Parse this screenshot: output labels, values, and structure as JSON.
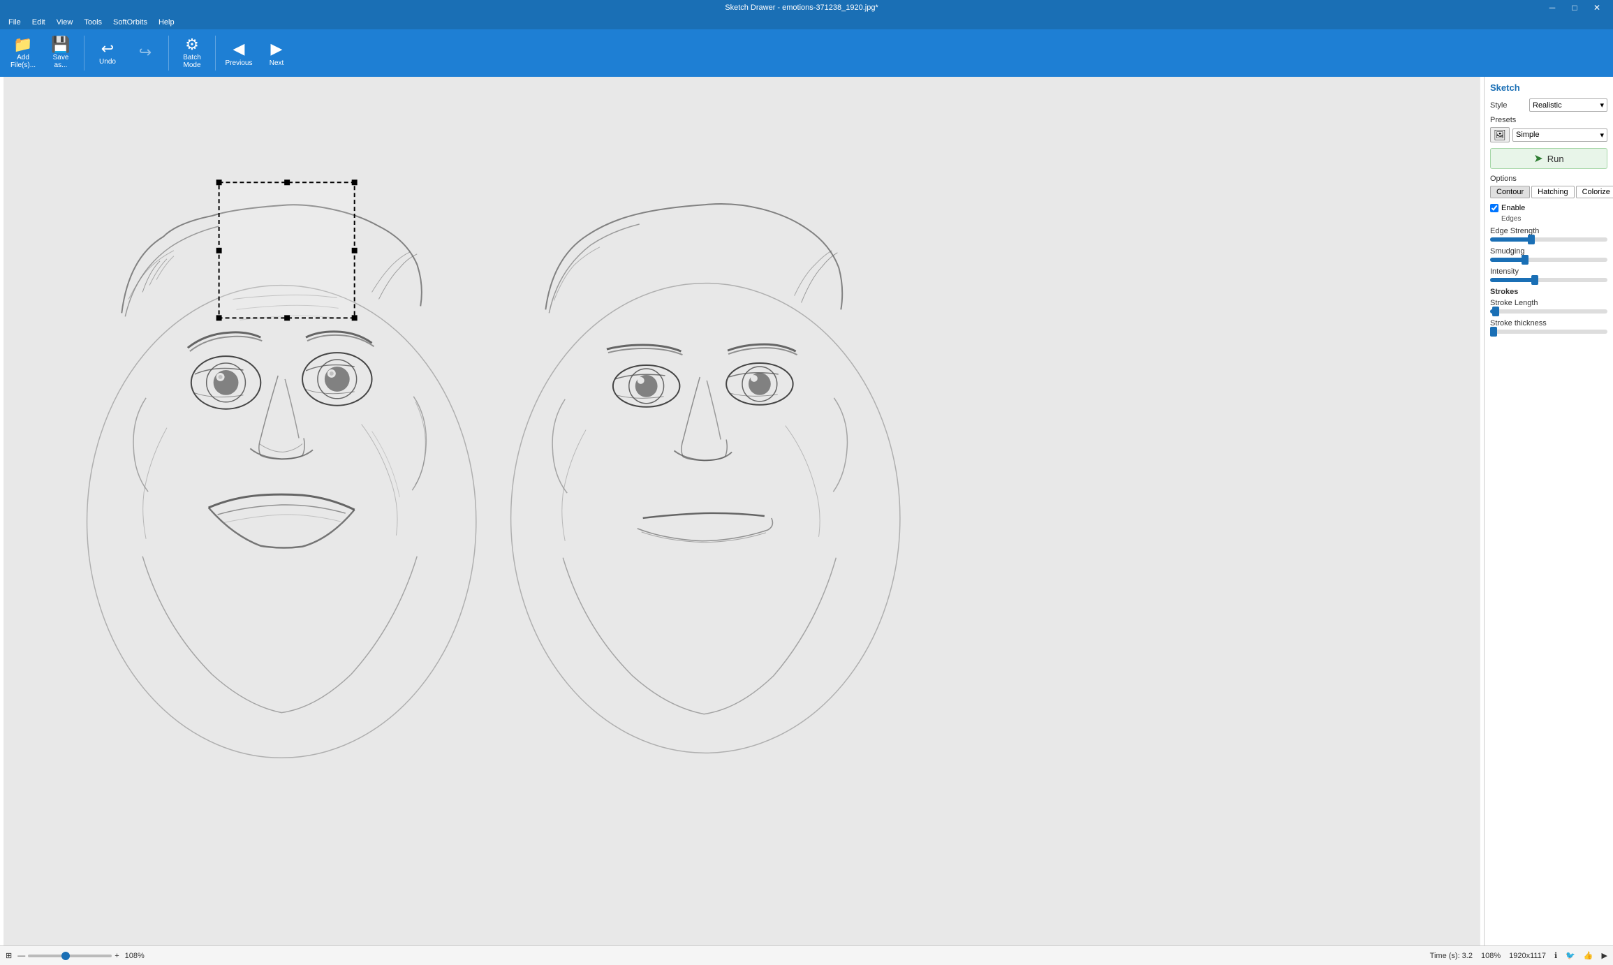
{
  "window": {
    "title": "Sketch Drawer - emotions-371238_1920.jpg*",
    "minimize_label": "─",
    "maximize_label": "□",
    "close_label": "✕"
  },
  "menu": {
    "items": [
      "File",
      "Edit",
      "View",
      "Tools",
      "SoftOrbits",
      "Help"
    ]
  },
  "toolbar": {
    "add_files_label": "Add\nFile(s)...",
    "save_as_label": "Save\nas...",
    "undo_label": "Undo",
    "redo_label": "",
    "batch_mode_label": "Batch\nMode",
    "previous_label": "Previous",
    "next_label": "Next"
  },
  "right_panel": {
    "title": "Sketch",
    "style_label": "Style",
    "style_value": "Realistic",
    "presets_label": "Presets",
    "preset_value": "Simple",
    "run_label": "Run",
    "options_label": "Options",
    "tabs": [
      "Contour",
      "Hatching",
      "Colorize"
    ],
    "enable_edges_label": "Enable",
    "edges_label": "Edges",
    "edge_strength_label": "Edge Strength",
    "edge_strength_pct": 35,
    "smudging_label": "Smudging",
    "smudging_pct": 30,
    "intensity_label": "Intensity",
    "intensity_pct": 38,
    "strokes_label": "Strokes",
    "stroke_length_label": "Stroke Length",
    "stroke_length_pct": 5,
    "stroke_thickness_label": "Stroke thickness",
    "stroke_thickness_pct": 3
  },
  "status_bar": {
    "time_label": "Time (s): 3.2",
    "zoom_label": "108%",
    "dimensions": "1920x1117",
    "zoom_value": "108%"
  }
}
